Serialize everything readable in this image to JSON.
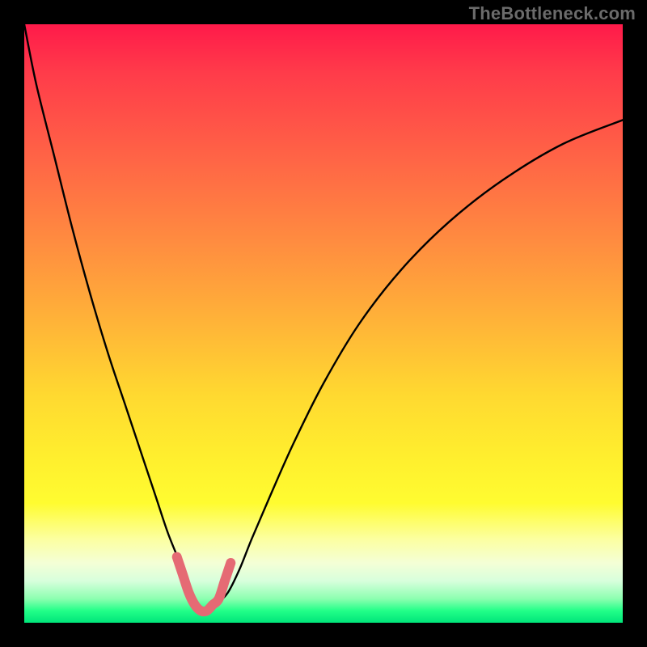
{
  "watermark": "TheBottleneck.com",
  "colors": {
    "background_black": "#000000",
    "gradient_top_red": "#ff1a4a",
    "gradient_mid_orange": "#ff8b40",
    "gradient_mid_yellow": "#ffee2e",
    "gradient_bottom_green": "#00e57a",
    "curve_black": "#000000",
    "highlight_path": "#e56a74"
  },
  "chart_data": {
    "type": "line",
    "title": "",
    "xlabel": "",
    "ylabel": "",
    "xlim": [
      0,
      100
    ],
    "ylim": [
      0,
      100
    ],
    "grid": false,
    "legend": false,
    "series": [
      {
        "name": "bottleneck-curve",
        "x": [
          0,
          2,
          5,
          8,
          11,
          14,
          17,
          20,
          22,
          24,
          26,
          27,
          28,
          29,
          30,
          31,
          32,
          34,
          36,
          38,
          41,
          45,
          50,
          56,
          63,
          71,
          80,
          90,
          100
        ],
        "y": [
          100,
          90,
          78,
          66,
          55,
          45,
          36,
          27,
          21,
          15,
          10,
          7,
          5,
          3,
          2,
          2,
          3,
          5,
          9,
          14,
          21,
          30,
          40,
          50,
          59,
          67,
          74,
          80,
          84
        ]
      },
      {
        "name": "highlight-segment",
        "x": [
          25.5,
          26.5,
          27.5,
          28.5,
          29.5,
          30.5,
          31.5,
          32.5,
          33.5,
          34.5
        ],
        "y": [
          11,
          8,
          5,
          3,
          2,
          2,
          3,
          4,
          7,
          10
        ]
      }
    ]
  }
}
